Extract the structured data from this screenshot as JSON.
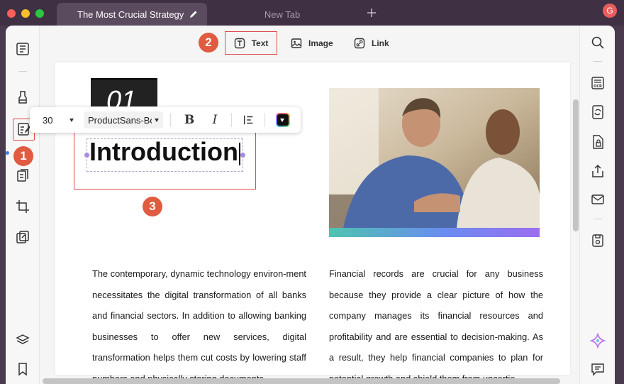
{
  "tabs": [
    {
      "title": "The Most Crucial Strategy",
      "active": true
    },
    {
      "title": "New Tab",
      "active": false
    }
  ],
  "account": {
    "initial": "G"
  },
  "toolbar": {
    "text_label": "Text",
    "image_label": "Image",
    "link_label": "Link"
  },
  "callouts": {
    "one": "1",
    "two": "2",
    "three": "3"
  },
  "format_bar": {
    "font_size": "30",
    "font_family": "ProductSans-Bold"
  },
  "document": {
    "section_number": "01",
    "heading": "Introduction",
    "left_paragraph": "The contemporary, dynamic technology environ-ment necessitates the digital transformation of all banks and financial sectors. In addition to allowing banking businesses to offer new services, digital transformation helps them cut costs by lowering staff numbers and physically storing documents",
    "right_paragraph": "Financial records are crucial for any business because they provide a clear picture of how the company manages its financial resources and profitability and are essential to decision-making. As a result, they help financial companies to plan for potential growth and shield them from uncertie"
  },
  "colors": {
    "accent_red": "#e04a4a",
    "badge": "#e05b3f",
    "selection": "#a98be0",
    "photo_gradient": [
      "#4fc3b0",
      "#6a8cf0",
      "#9b6ef0"
    ]
  }
}
